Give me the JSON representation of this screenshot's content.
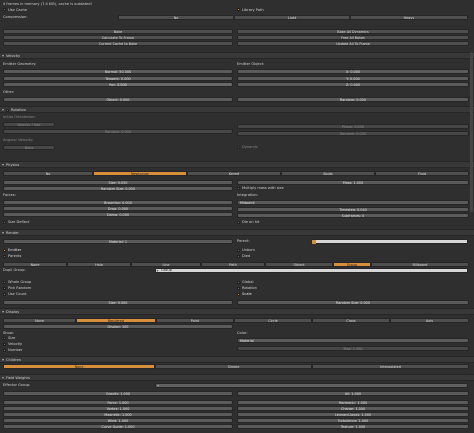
{
  "top": {
    "status": "4 frames in memory (7.4 KiB), cache is outdated!",
    "use_cache": "Use Cache",
    "library_path": "Library Path",
    "compression": "Compression:",
    "compression_options": [
      "No",
      "Light",
      "Heavy"
    ]
  },
  "bake": {
    "bake": "Bake",
    "calc_to_frame": "Calculate To Frame",
    "current_cache_to_bake": "Current Cache to Bake",
    "bake_all_dynamics": "Bake All Dynamics",
    "free_all_bakes": "Free All Bakes",
    "update_all_to_frame": "Update All To Frame"
  },
  "velocity": {
    "title": "Velocity",
    "emitter_geometry": "Emitter Geometry:",
    "normal": "Normal: 50.000",
    "tangent": "Tangent: 0.000",
    "rot": "Rot: 0.000",
    "emitter_object": "Emitter Object:",
    "x": "X: 0.000",
    "y": "Y: 0.000",
    "z": "Z: 0.000",
    "other": "Other:",
    "object": "Object: 0.000",
    "random": "Random: 0.000"
  },
  "rotation": {
    "title": "Rotation",
    "initial_orientation": "Initial Orientation:",
    "velocity_axis": "Velocity / Hair",
    "random": "Random: 0.000",
    "phase": "Phase: 0.000",
    "angular_velocity": "Angular Velocity:",
    "none": "None",
    "dynamic": "Dynamic"
  },
  "physics": {
    "title": "Physics",
    "types": [
      "No",
      "Newtonian",
      "Keyed",
      "Boids",
      "Fluid"
    ],
    "size": "Size: 0.050",
    "random_size": "Random Size: 0.000",
    "mass": "Mass: 1.000",
    "multiply_mass": "Multiply mass with size",
    "forces": "Forces:",
    "brownian": "Brownian: 0.000",
    "drag": "Drag: 0.000",
    "damp": "Damp: 0.000",
    "size_deflect": "Size Deflect",
    "integration": "Integration:",
    "midpoint": "Midpoint",
    "timestep": "Timestep: 0.040",
    "subframes": "Subframes: 0",
    "die_on_hit": "Die on hit"
  },
  "render": {
    "title": "Render",
    "material": "Material: 1",
    "parent": "Parent:",
    "emitter": "Emitter",
    "parents": "Parents",
    "unborn": "Unborn",
    "died": "Died",
    "modes": [
      "None",
      "Halo",
      "Line",
      "Path",
      "Object",
      "Group",
      "Billboard"
    ],
    "dupli_group": "Dupli Group:",
    "group_value": "Group",
    "whole_group": "Whole Group",
    "pick_random": "Pick Random",
    "use_count": "Use Count",
    "global": "Global",
    "rotation": "Rotation",
    "scale": "Scale",
    "size": "Size: 0.500",
    "random_size": "Random Size: 0.000"
  },
  "display": {
    "title": "Display",
    "modes": [
      "None",
      "Rendered",
      "Point",
      "Circle",
      "Cross",
      "Axis"
    ],
    "display_pct": "Display: 100",
    "show": "Show:",
    "size": "Size",
    "velocity": "Velocity",
    "number": "Number",
    "color": "Color:",
    "material": "Material",
    "max": "Max: 1.000"
  },
  "children": {
    "title": "Children",
    "modes": [
      "None",
      "Simple",
      "Interpolated"
    ]
  },
  "field_weights": {
    "title": "Field Weights",
    "effector_group": "Effector Group:",
    "gravity": "Gravity: 1.000",
    "all": "All: 1.000",
    "force": "Force: 1.000",
    "harmonic": "Harmonic: 1.000",
    "vortex": "Vortex: 1.000",
    "charge": "Charge: 1.000",
    "magnetic": "Magnetic: 1.000",
    "lennard_jones": "Lennard-Jones: 1.000",
    "wind": "Wind: 1.000",
    "turbulence": "Turbulence: 1.000",
    "curve_guide": "Curve Guide: 1.000",
    "texture": "Texture: 1.000"
  }
}
